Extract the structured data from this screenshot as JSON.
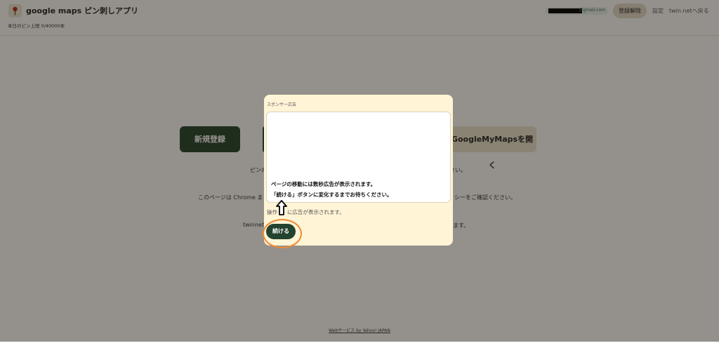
{
  "header": {
    "app_title": "google maps ピン刺しアプリ",
    "usage": "本日のピン上限 0/40000本",
    "email_suffix": "@gmail.com",
    "unregister_label": "登録解除",
    "settings_label": "設定",
    "back_label": "twin.netへ戻る"
  },
  "main": {
    "new_button_label": "新規登録",
    "mymaps_button_label": "GoogleMyMapsを開く",
    "line1_left": "ピンの",
    "line1_right": "さい。",
    "line2_left": "このページは Chrome ま",
    "line2_right": "シーをご確認ください。",
    "line3_left": "twinnet",
    "line3_right": "ます。"
  },
  "footer": {
    "link_label": "Webサービス by Yahoo! JAPAN"
  },
  "modal": {
    "sponsor_label": "スポンサー広告",
    "ad_message_1": "ページの移動には数秒広告が表示されます。",
    "ad_message_2": "「続ける」ボタンに変化するまでお待ちください。",
    "note_left": "操作",
    "note_right": "に広告が表示されます。",
    "continue_label": "続ける"
  },
  "colors": {
    "primary": "#23432f",
    "modal_bg": "#fff4d6",
    "highlight": "#ee8a32",
    "secondary_button": "#ece4d2"
  },
  "icons": {
    "logo": "map-pin-icon",
    "annotation_arrow": "arrow-up-icon"
  }
}
